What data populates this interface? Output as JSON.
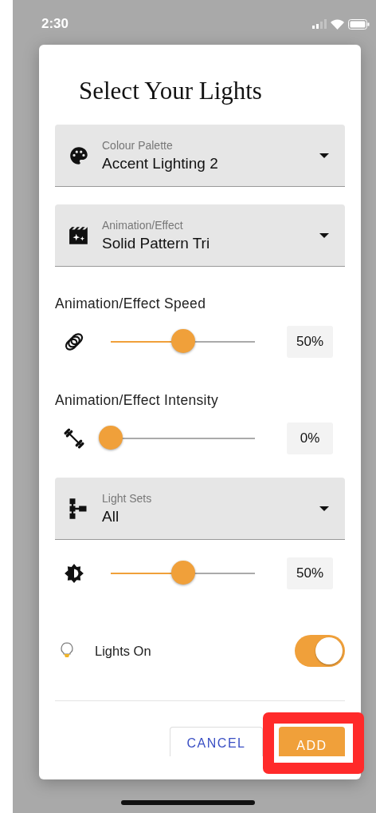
{
  "status_bar": {
    "time": "2:30"
  },
  "dialog": {
    "title": "Select Your Lights",
    "fields": [
      {
        "kind": "select",
        "label": "Colour Palette",
        "value": "Accent Lighting 2"
      },
      {
        "kind": "select",
        "label": "Animation/Effect",
        "value": "Solid Pattern Tri"
      },
      {
        "kind": "slider",
        "label": "Animation/Effect Speed",
        "level": 0.5,
        "reading": "50%"
      },
      {
        "kind": "slider",
        "label": "Animation/Effect Intensity",
        "level": 0,
        "reading": "0%"
      },
      {
        "kind": "select",
        "label": "Light Sets",
        "value": "All"
      },
      {
        "kind": "slider",
        "level": 0.5,
        "reading": "50%"
      },
      {
        "kind": "toggle",
        "label": "Lights On",
        "on": true
      }
    ],
    "buttons": [
      {
        "kind": "text",
        "label": "CANCEL",
        "highlighted": false
      },
      {
        "kind": "filled",
        "label": "ADD",
        "highlighted": true
      }
    ]
  }
}
